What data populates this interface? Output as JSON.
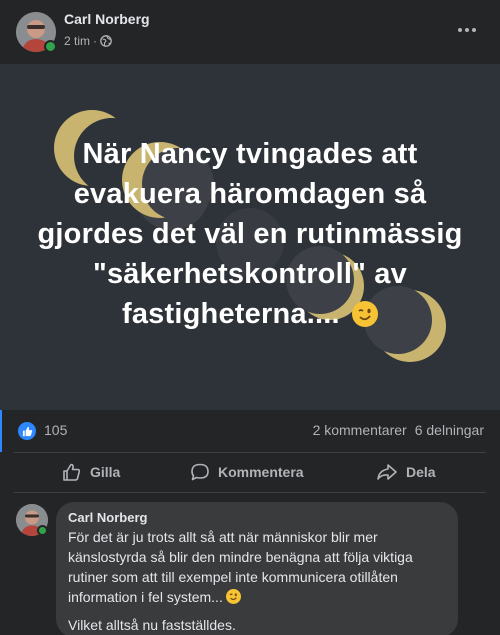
{
  "post": {
    "author": "Carl Norberg",
    "time": "2 tim",
    "separator": "·",
    "visibility_icon": "globe-icon",
    "image_text": "När Nancy tvingades att evakuera häromdagen så gjordes det väl en rutinmässig \"säkerhetskontroll\" av fastigheterna....",
    "image_emoji": "winking-face-icon"
  },
  "stats": {
    "reaction_icon": "like-icon",
    "likes": "105",
    "comments": "2 kommentarer",
    "shares": "6 delningar"
  },
  "actions": {
    "like": "Gilla",
    "comment": "Kommentera",
    "share": "Dela"
  },
  "comment": {
    "author": "Carl Norberg",
    "text": "För det är ju trots allt så att när människor blir mer känslostyrda så blir den mindre benägna att följa viktiga rutiner som att till exempel inte kommunicera otillåten information i fel system...",
    "text2": "Vilket alltså nu fastställdes.",
    "emoji": "winking-face-icon"
  },
  "colors": {
    "background": "#242526",
    "image_background": "#2e3339",
    "accent": "#2d88ff",
    "online": "#31a24c",
    "moon": "#c8b46e"
  }
}
